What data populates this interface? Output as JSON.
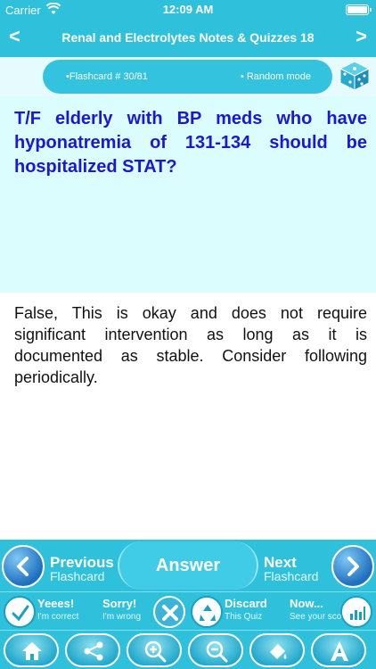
{
  "status_bar": {
    "carrier": "Carrier",
    "time": "12:09 AM"
  },
  "nav": {
    "title": "Renal and Electrolytes Notes & Quizzes 18",
    "back": "<",
    "forward": ">"
  },
  "info": {
    "counter": "•Flashcard #  30/81",
    "mode": "• Random mode"
  },
  "question": "T/F elderly with BP meds who have hyponatremia of 131-134 should be hospitalized STAT?",
  "answer": "False, This is okay and does not require significant intervention as long as it is documented as stable. Consider following periodically.",
  "controls": {
    "previous": {
      "line1": "Previous",
      "line2": "Flashcard"
    },
    "answer": "Answer",
    "next": {
      "line1": "Next",
      "line2": "Flashcard"
    }
  },
  "actions": [
    {
      "title": "Yeees!",
      "sub": "I'm correct"
    },
    {
      "title": "Sorry!",
      "sub": "I'm wrong"
    },
    {
      "title": "Discard",
      "sub": "This Quiz"
    },
    {
      "title": "Now...",
      "sub": "See your score"
    }
  ],
  "toolbar_icons": [
    "home-icon",
    "share-icon",
    "zoom-in-icon",
    "zoom-out-icon",
    "font-color-icon",
    "font-icon"
  ],
  "colors": {
    "bar": "#2fc0dc",
    "question_bg": "#dcfdfe",
    "question_text": "#1b16d8"
  }
}
